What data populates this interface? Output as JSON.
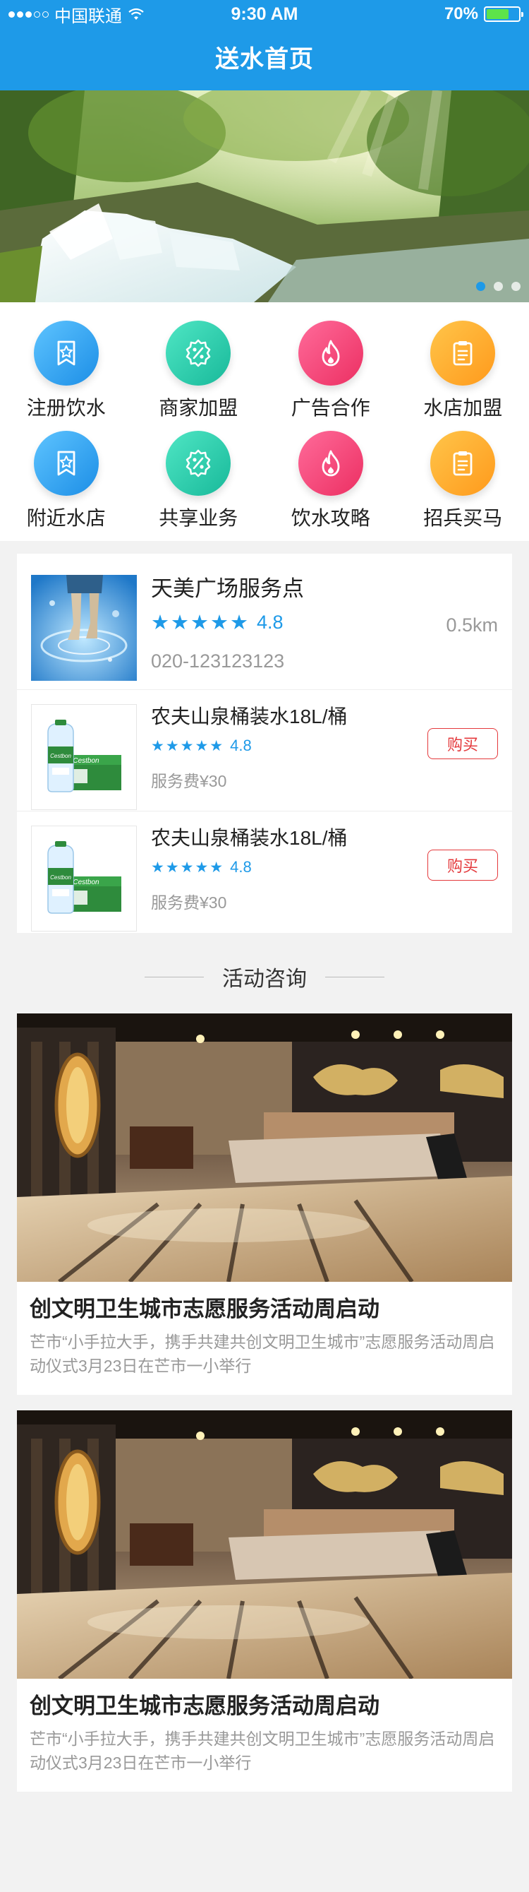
{
  "status_bar": {
    "carrier": "中国联通",
    "time": "9:30 AM",
    "battery_percent": "70%",
    "battery_level": 0.7
  },
  "header": {
    "title": "送水首页"
  },
  "banner": {
    "image": "waterfall-forest",
    "slide_count": 3,
    "active_slide": 1
  },
  "categories": [
    {
      "label": "注册饮水",
      "icon": "star-badge-icon",
      "color": "#1c8ee6"
    },
    {
      "label": "商家加盟",
      "icon": "percent-badge-icon",
      "color": "#18b99a"
    },
    {
      "label": "广告合作",
      "icon": "flame-icon",
      "color": "#ec2f62"
    },
    {
      "label": "水店加盟",
      "icon": "clipboard-icon",
      "color": "#ff9a1c"
    },
    {
      "label": "附近水店",
      "icon": "star-badge-icon",
      "color": "#1c8ee6"
    },
    {
      "label": "共享业务",
      "icon": "percent-badge-icon",
      "color": "#18b99a"
    },
    {
      "label": "饮水攻略",
      "icon": "flame-icon",
      "color": "#ec2f62"
    },
    {
      "label": "招兵买马",
      "icon": "clipboard-icon",
      "color": "#ff9a1c"
    }
  ],
  "store": {
    "name": "天美广场服务点",
    "stars": 5,
    "rating": "4.8",
    "phone": "020-123123123",
    "distance": "0.5km"
  },
  "products": [
    {
      "name": "农夫山泉桶装水18L/桶",
      "stars": 5,
      "rating": "4.8",
      "fee": "服务费¥30",
      "buy_label": "购买"
    },
    {
      "name": "农夫山泉桶装水18L/桶",
      "stars": 5,
      "rating": "4.8",
      "fee": "服务费¥30",
      "buy_label": "购买"
    }
  ],
  "news_section": {
    "title": "活动咨询"
  },
  "news": [
    {
      "title": "创文明卫生城市志愿服务活动周启动",
      "desc": "芒市“小手拉大手，携手共建共创文明卫生城市”志愿服务活动周启动仪式3月23日在芒市一小举行"
    },
    {
      "title": "创文明卫生城市志愿服务活动周启动",
      "desc": "芒市“小手拉大手，携手共建共创文明卫生城市”志愿服务活动周启动仪式3月23日在芒市一小举行"
    }
  ],
  "colors": {
    "primary": "#1e9ae8",
    "buy_button": "#e4393c",
    "secondary_text": "#999999",
    "background": "#f2f2f2"
  }
}
